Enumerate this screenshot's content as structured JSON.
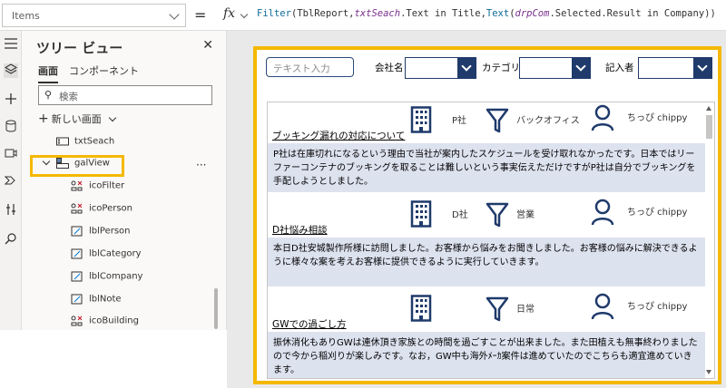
{
  "formula_bar": {
    "property": "Items",
    "equals": "=",
    "fx": "fx",
    "formula_parts": [
      {
        "t": "Filter",
        "k": "fn"
      },
      {
        "t": "(TblReport,",
        "k": "p"
      },
      {
        "t": "txtSeach",
        "k": "id"
      },
      {
        "t": ".Text in Title,",
        "k": "p"
      },
      {
        "t": "Text",
        "k": "fn"
      },
      {
        "t": "(",
        "k": "p"
      },
      {
        "t": "drpCom",
        "k": "id"
      },
      {
        "t": ".Selected.Result in Company))",
        "k": "p"
      }
    ]
  },
  "tree_view": {
    "title": "ツリー ビュー",
    "close_icon": "close-icon",
    "tabs": [
      "画面",
      "コンポーネント"
    ],
    "search_placeholder": "検索",
    "new_screen_label": "新しい画面",
    "items": [
      {
        "label": "txtSeach",
        "icon": "text-input-icon"
      },
      {
        "label": "galView",
        "icon": "gallery-icon"
      },
      {
        "label": "icoFilter",
        "icon": "icon-control-icon"
      },
      {
        "label": "icoPerson",
        "icon": "icon-control-icon"
      },
      {
        "label": "lblPerson",
        "icon": "label-icon"
      },
      {
        "label": "lblCategory",
        "icon": "label-icon"
      },
      {
        "label": "lblCompany",
        "icon": "label-icon"
      },
      {
        "label": "lblNote",
        "icon": "label-icon"
      },
      {
        "label": "icoBuilding",
        "icon": "icon-control-icon"
      }
    ],
    "more_label": "···"
  },
  "app": {
    "text_input_placeholder": "テキスト入力",
    "filters": [
      {
        "label": "会社名"
      },
      {
        "label": "カテゴリ"
      },
      {
        "label": "記入者"
      }
    ],
    "gallery": [
      {
        "title": "ブッキング漏れの対応について",
        "company": "P社",
        "category": "バックオフィス",
        "author": "ちっぴ chippy",
        "note": "P社は在庫切れになるという理由で当社が案内したスケジュールを受け取れなかったです。日本ではリーファーコンテナのブッキングを取ることは難しいという事実伝えただけですがP社は自分でブッキングを手配しようとしました。"
      },
      {
        "title": "D社悩み相談",
        "company": "D社",
        "category": "営業",
        "author": "ちっぴ chippy",
        "note": "本日D社安城製作所様に訪問しました。お客様から悩みをお聞きしました。お客様の悩みに解決できるように様々な案を考えお客様に提供できるように実行していきます。"
      },
      {
        "title": "GWでの過ごし方",
        "company": "",
        "category": "日常",
        "author": "ちっぴ chippy",
        "note": "振休消化もありGWは連休頂き家族との時間を過ごすことが出来ました。また田植えも無事終わりましたので今から稲刈りが楽しみです。なお，GW中も海外ﾒｰｶ案件は進めていたのでこちらも適宜進めていきます。"
      }
    ]
  },
  "colors": {
    "highlight": "#f5b800",
    "navy": "#1f3a6b",
    "note_bg": "#dde2ef"
  }
}
